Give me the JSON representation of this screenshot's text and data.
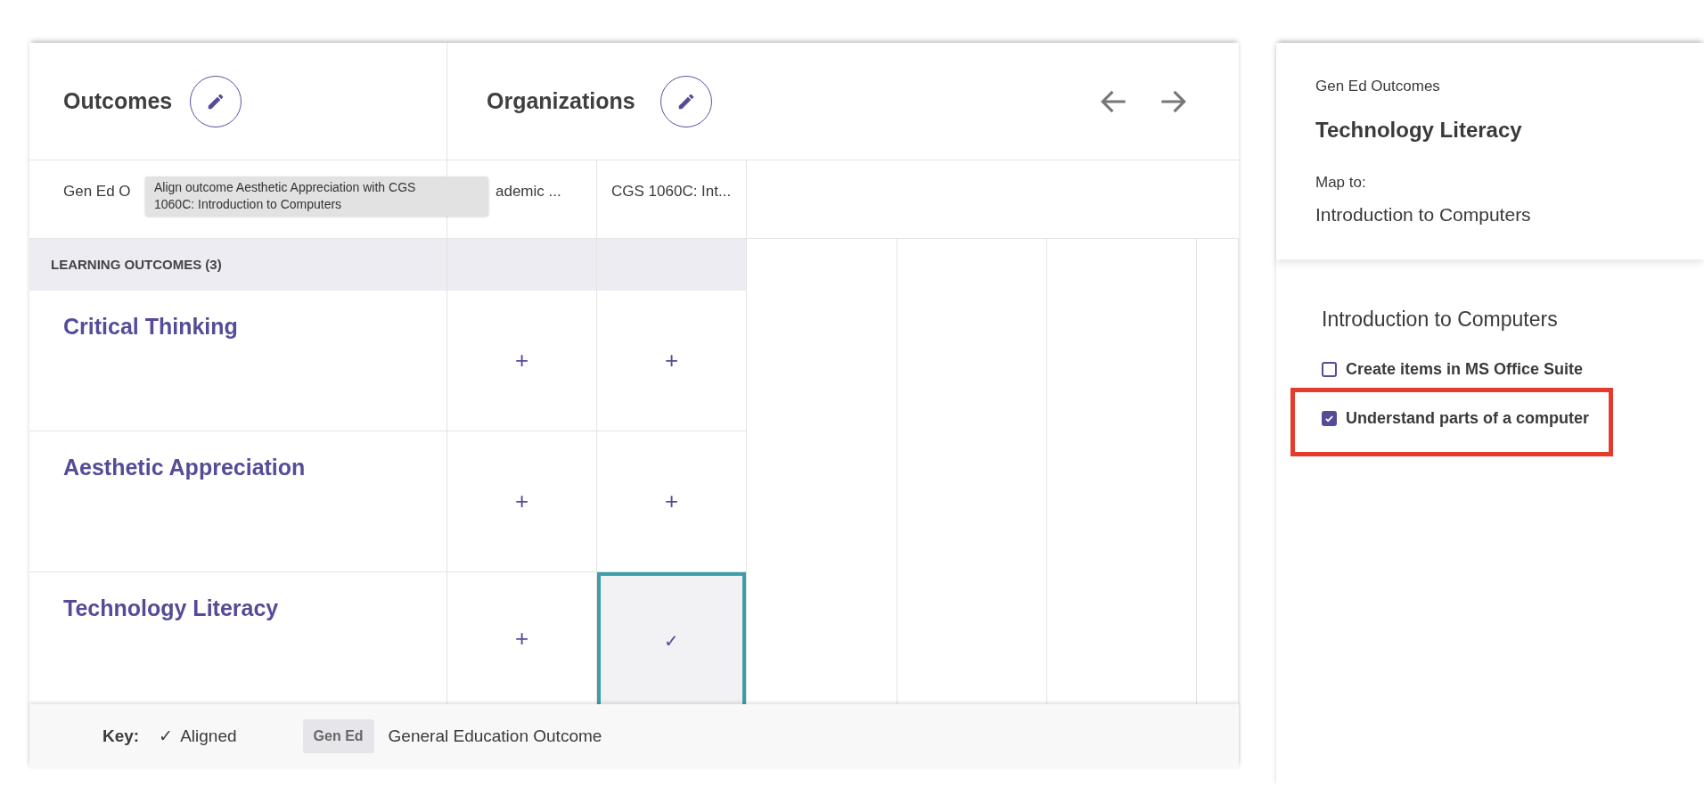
{
  "outcomes_header": {
    "title": "Outcomes"
  },
  "organizations_header": {
    "title": "Organizations"
  },
  "columns": [
    {
      "label": "Gen Ed O"
    },
    {
      "label": "ademic ..."
    },
    {
      "label": "CGS 1060C: Int..."
    }
  ],
  "tooltip": {
    "text": "Align outcome Aesthetic Appreciation with CGS 1060C: Introduction to Computers"
  },
  "section": {
    "label": "LEARNING OUTCOMES (3)"
  },
  "rows": [
    {
      "outcome": "Critical Thinking",
      "cells": [
        {
          "kind": "add",
          "text": "+",
          "selected": false
        },
        {
          "kind": "add",
          "text": "+",
          "selected": false
        }
      ]
    },
    {
      "outcome": "Aesthetic Appreciation",
      "cells": [
        {
          "kind": "add",
          "text": "+",
          "selected": false
        },
        {
          "kind": "add",
          "text": "+",
          "selected": false
        }
      ]
    },
    {
      "outcome": "Technology Literacy",
      "cells": [
        {
          "kind": "add",
          "text": "+",
          "selected": false
        },
        {
          "kind": "aligned",
          "text": "✓",
          "selected": true
        }
      ]
    }
  ],
  "key": {
    "label": "Key:",
    "aligned_mark": "✓",
    "aligned_label": "Aligned",
    "tag": "Gen Ed",
    "tag_label": "General Education Outcome"
  },
  "detail": {
    "category": "Gen Ed Outcomes",
    "outcome": "Technology Literacy",
    "map_label": "Map to:",
    "map_target": "Introduction to Computers"
  },
  "course": {
    "title": "Introduction to Computers",
    "items": [
      {
        "label": "Create items in MS Office Suite",
        "checked": false,
        "highlighted": false
      },
      {
        "label": "Understand parts of a computer",
        "checked": true,
        "highlighted": true
      }
    ]
  }
}
